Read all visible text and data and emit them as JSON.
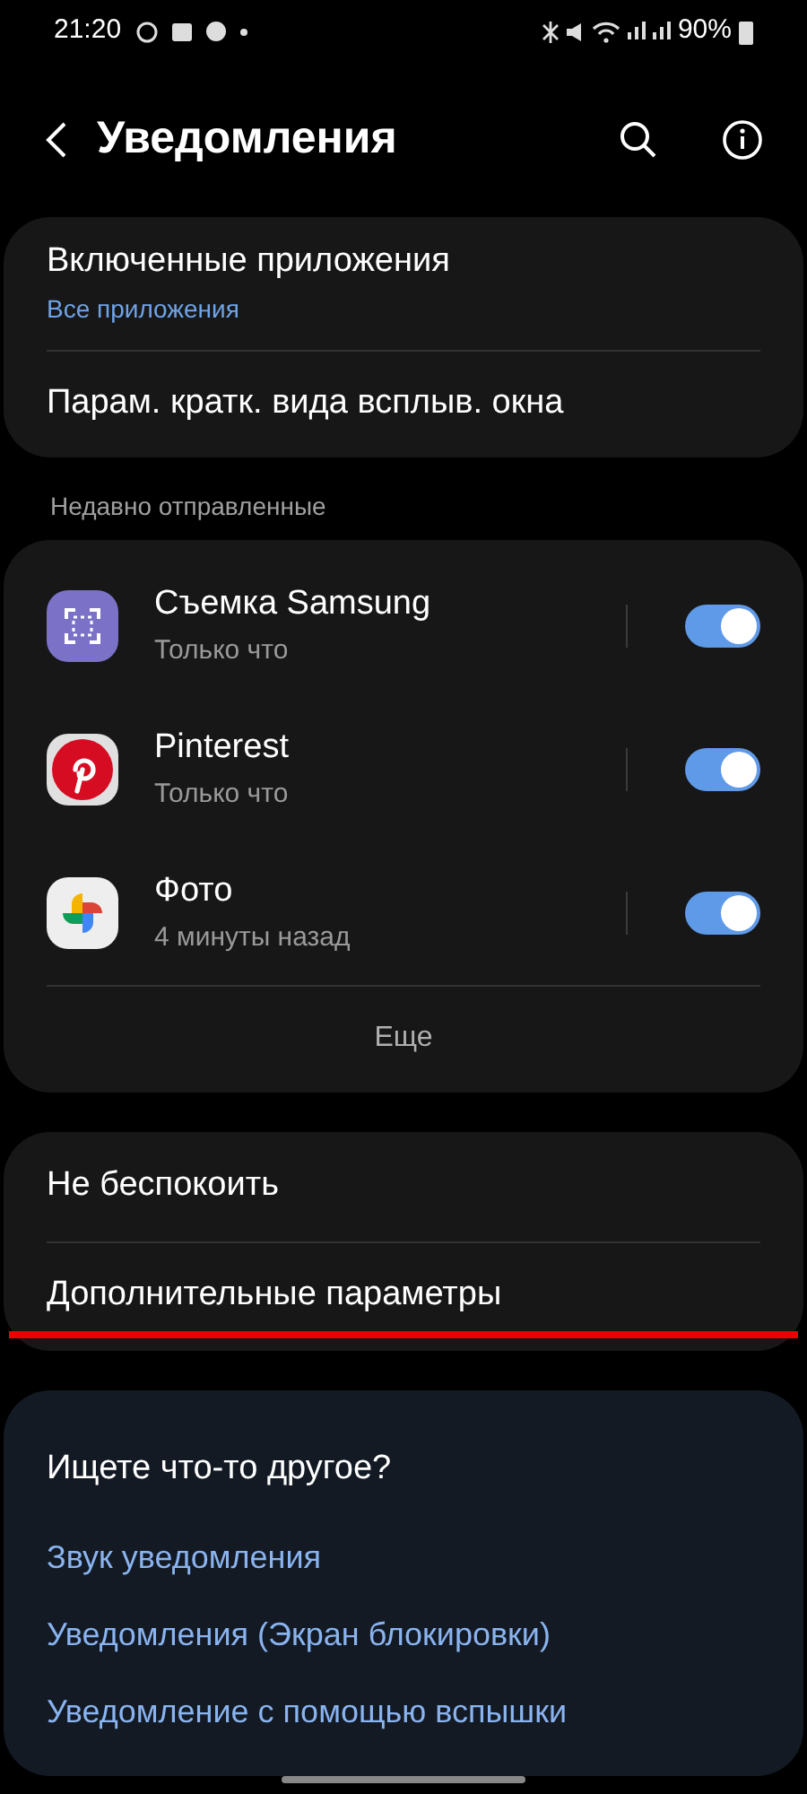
{
  "status_bar": {
    "time": "21:20",
    "battery": "90%"
  },
  "header": {
    "title": "Уведомления"
  },
  "main_card": {
    "items": [
      {
        "label": "Включенные приложения",
        "sublabel": "Все приложения"
      },
      {
        "label": "Парам. кратк. вида всплыв. окна"
      }
    ]
  },
  "recent": {
    "heading": "Недавно отправленные",
    "apps": [
      {
        "name": "Съемка Samsung",
        "time": "Только что",
        "on": true
      },
      {
        "name": "Pinterest",
        "time": "Только что",
        "on": true
      },
      {
        "name": "Фото",
        "time": "4 минуты назад",
        "on": true
      }
    ],
    "more": "Еще"
  },
  "options_card": {
    "items": [
      "Не беспокоить",
      "Дополнительные параметры"
    ],
    "underline_annotation": true
  },
  "suggestions": {
    "heading": "Ищете что-то другое?",
    "links": [
      "Звук уведомления",
      "Уведомления (Экран блокировки)",
      "Уведомление с помощью вспышки"
    ]
  }
}
